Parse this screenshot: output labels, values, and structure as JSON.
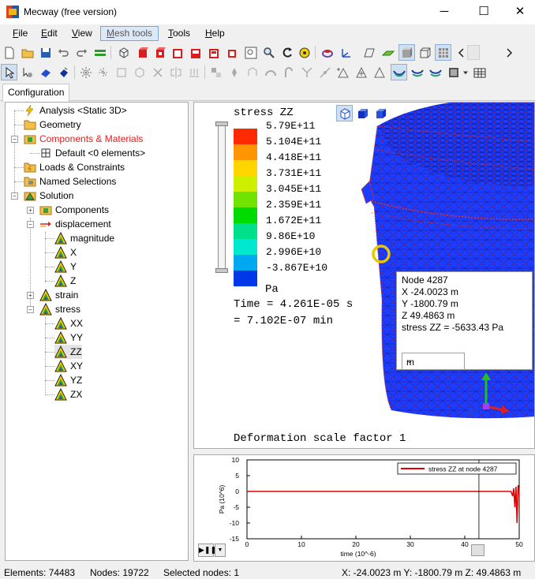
{
  "window": {
    "title": "Mecway (free version)",
    "minimize": "─",
    "maximize": "☐",
    "close": "✕"
  },
  "menu": [
    {
      "label_m": "F",
      "label_rest": "ile"
    },
    {
      "label_m": "E",
      "label_rest": "dit"
    },
    {
      "label_m": "V",
      "label_rest": "iew"
    },
    {
      "label_m": "M",
      "label_rest": "esh tools"
    },
    {
      "label_m": "T",
      "label_rest": "ools"
    },
    {
      "label_m": "H",
      "label_rest": "elp"
    }
  ],
  "toolbar1_icons": [
    "new-file-icon",
    "open-folder-icon",
    "save-icon",
    "undo-icon",
    "redo-icon",
    "green-bars-icon",
    "wireframe-cube-icon",
    "red-cube-icon",
    "red-cube-cut-icon",
    "red-cube-outline-icon",
    "red-cube-half-icon",
    "red-cube-plain-icon",
    "red-cube-edge-icon",
    "zoom-box-icon",
    "magnifier-icon",
    "rotate-icon",
    "pan-icon",
    "ring-icon",
    "axes-icon",
    "green-plate-icon",
    "shaded-view-icon",
    "solid-view-icon",
    "edge-view-icon"
  ],
  "toolbar2_icons": [
    "select-arrow-icon",
    "select-node-icon",
    "select-face-icon",
    "select-element-icon",
    "select-star-icon",
    "select-spread-icon",
    "select-box-icon",
    "select-cube-icon",
    "delete-x-icon",
    "mirror-icon",
    "node-snap-icon",
    "copy-node-icon",
    "move-icon",
    "extrude-icon",
    "arc-icon",
    "hook-icon",
    "merge-icon",
    "link-icon",
    "triangle-plus-icon",
    "triangle-dot-icon",
    "triangle-icon",
    "mesh-active-icon",
    "mesh-wave-icon",
    "mesh-wave2-icon",
    "film-icon",
    "dropdown-icon",
    "table-icon"
  ],
  "tabs": {
    "configuration": "Configuration"
  },
  "tree": {
    "analysis": "Analysis <Static 3D>",
    "geometry": "Geometry",
    "components_materials": "Components & Materials",
    "default": "Default <0 elements>",
    "loads": "Loads & Constraints",
    "named_selections": "Named Selections",
    "solution": "Solution",
    "components": "Components",
    "displacement": "displacement",
    "magnitude": "magnitude",
    "x": "X",
    "y": "Y",
    "z": "Z",
    "strain": "strain",
    "stress": "stress",
    "xx": "XX",
    "yy": "YY",
    "zz": "ZZ",
    "xy": "XY",
    "yz": "YZ",
    "zx": "ZX"
  },
  "legend": {
    "title": "stress ZZ",
    "unit": "Pa",
    "values": [
      "5.79E+11",
      "5.104E+11",
      "4.418E+11",
      "3.731E+11",
      "3.045E+11",
      "2.359E+11",
      "1.672E+11",
      "9.86E+10",
      "2.996E+10",
      "-3.867E+10"
    ],
    "colors": [
      "#ff2a00",
      "#ff9500",
      "#ffd500",
      "#cfef00",
      "#70e400",
      "#00dc00",
      "#00e08a",
      "#00e8d0",
      "#00a8f0",
      "#0038e8"
    ]
  },
  "viewport": {
    "time_line1": "Time = 4.261E-05 s",
    "time_line2": "= 7.102E-07 min",
    "deformation": "Deformation scale factor 1"
  },
  "node_info": {
    "node": "Node  4287",
    "x": "X -24.0023 m",
    "y": "Y -1800.79 m",
    "z": "Z 49.4863 m",
    "stress": "stress ZZ = -5633.43 Pa",
    "unit_selected": "m"
  },
  "graph": {
    "legend": "stress ZZ at node 4287",
    "xlabel": "time (10^-6)",
    "ylabel": "Pa (10^6)"
  },
  "chart_data": {
    "type": "line",
    "title": "",
    "xlabel": "time (10^-6)",
    "ylabel": "Pa (10^6)",
    "xlim": [
      0,
      50
    ],
    "ylim": [
      -15,
      10
    ],
    "xticks": [
      "0",
      "10",
      "20",
      "30",
      "40",
      "50"
    ],
    "yticks": [
      "10",
      "5",
      "0",
      "-5",
      "-10",
      "-15"
    ],
    "series": [
      {
        "name": "stress ZZ at node 4287",
        "color": "#e00000",
        "x": [
          0,
          5,
          10,
          15,
          20,
          25,
          30,
          35,
          40,
          45,
          48.5,
          48.8,
          49.0,
          49.2,
          49.4,
          49.6,
          49.8,
          50
        ],
        "y": [
          0,
          0,
          0,
          0,
          0,
          0,
          0,
          0,
          0,
          0,
          0,
          -1.5,
          1.0,
          -5,
          1.5,
          -10,
          2,
          -1
        ]
      }
    ],
    "cursor_time": 42.6,
    "legend_position": "top-right",
    "grid": false
  },
  "status": {
    "elements": "Elements: 74483",
    "nodes": "Nodes: 19722",
    "selected": "Selected nodes: 1",
    "coords": "X: -24.0023 m Y: -1800.79 m Z: 49.4863 m"
  }
}
